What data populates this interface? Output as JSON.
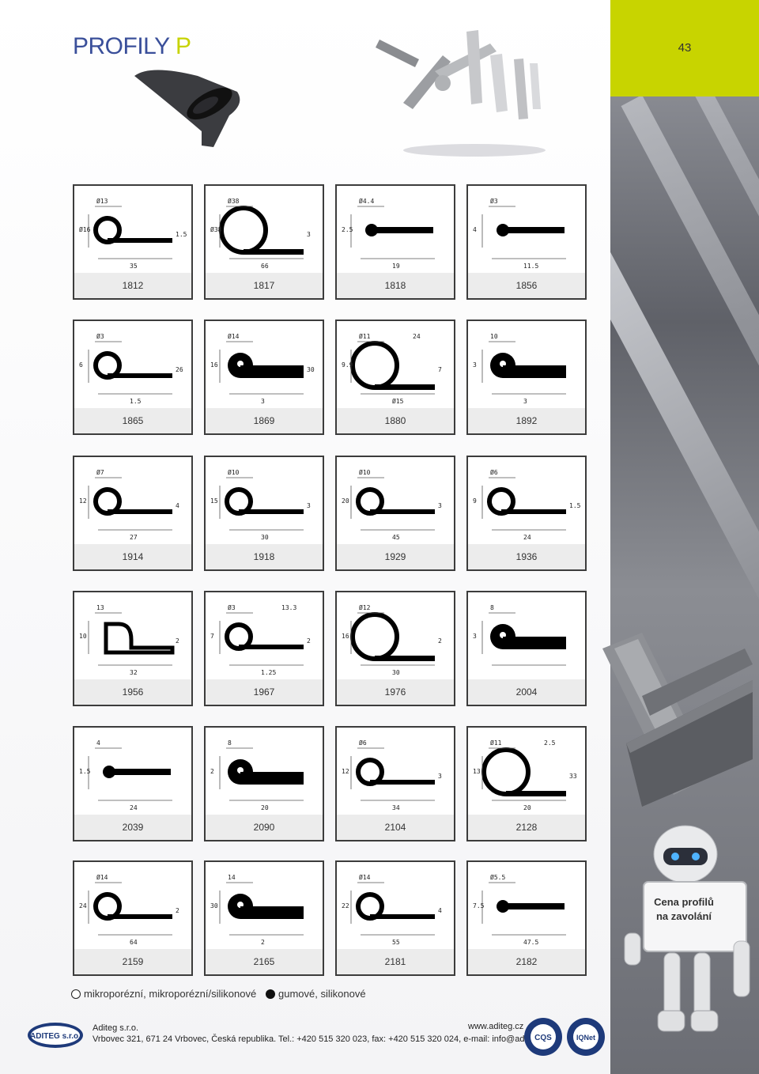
{
  "header": {
    "title_main": "PROFILY ",
    "title_accent": "P",
    "page_number": "43"
  },
  "profiles": [
    {
      "code": "1812",
      "dims": [
        "Ø13",
        "Ø16",
        "35",
        "1.5"
      ]
    },
    {
      "code": "1817",
      "dims": [
        "Ø38",
        "Ø38",
        "66",
        "3"
      ]
    },
    {
      "code": "1818",
      "dims": [
        "Ø4.4",
        "2.5",
        "19"
      ]
    },
    {
      "code": "1856",
      "dims": [
        "Ø3",
        "4",
        "11.5"
      ]
    },
    {
      "code": "1865",
      "dims": [
        "Ø3",
        "6",
        "1.5",
        "26"
      ]
    },
    {
      "code": "1869",
      "dims": [
        "Ø14",
        "16",
        "3",
        "30"
      ]
    },
    {
      "code": "1880",
      "dims": [
        "Ø11",
        "9.9",
        "Ø15",
        "7",
        "24"
      ]
    },
    {
      "code": "1892",
      "dims": [
        "10",
        "3",
        "3"
      ]
    },
    {
      "code": "1914",
      "dims": [
        "Ø7",
        "12",
        "27",
        "4"
      ]
    },
    {
      "code": "1918",
      "dims": [
        "Ø10",
        "15",
        "30",
        "3"
      ]
    },
    {
      "code": "1929",
      "dims": [
        "Ø10",
        "20",
        "45",
        "3"
      ]
    },
    {
      "code": "1936",
      "dims": [
        "Ø6",
        "9",
        "24",
        "1.5"
      ]
    },
    {
      "code": "1956",
      "dims": [
        "13",
        "10",
        "32",
        "2"
      ]
    },
    {
      "code": "1967",
      "dims": [
        "Ø3",
        "7",
        "1.25",
        "2",
        "13.3"
      ]
    },
    {
      "code": "1976",
      "dims": [
        "Ø12",
        "16",
        "30",
        "2"
      ]
    },
    {
      "code": "2004",
      "dims": [
        "8",
        "3"
      ]
    },
    {
      "code": "2039",
      "dims": [
        "4",
        "1.5",
        "24"
      ]
    },
    {
      "code": "2090",
      "dims": [
        "8",
        "2",
        "20"
      ]
    },
    {
      "code": "2104",
      "dims": [
        "Ø6",
        "12",
        "34",
        "3"
      ]
    },
    {
      "code": "2128",
      "dims": [
        "Ø11",
        "13",
        "20",
        "33",
        "2.5"
      ]
    },
    {
      "code": "2159",
      "dims": [
        "Ø14",
        "24",
        "64",
        "2"
      ]
    },
    {
      "code": "2165",
      "dims": [
        "14",
        "30",
        "2"
      ]
    },
    {
      "code": "2181",
      "dims": [
        "Ø14",
        "22",
        "55",
        "4"
      ]
    },
    {
      "code": "2182",
      "dims": [
        "Ø5.5",
        "7.5",
        "47.5"
      ]
    }
  ],
  "legend": {
    "open_label": "mikroporézní, mikroporézní/silikonové",
    "solid_label": "gumové, silikonové"
  },
  "robot_sign": {
    "line1": "Cena profilů",
    "line2": "na zavolání"
  },
  "footer": {
    "logo_text": "ADITEG s.r.o.",
    "company": "Aditeg s.r.o.",
    "website": "www.aditeg.cz",
    "address": "Vrbovec 321, 671 24  Vrbovec, Česká republika. Tel.: +420 515 320 023, fax: +420 515 320 024, e-mail: info@aditeg.cz",
    "cert1_text": "CQS",
    "cert2_text": "IQNet"
  },
  "colors": {
    "accent_blue": "#3a4f9a",
    "accent_lime": "#c8d400",
    "profile_fill": "#000000"
  }
}
